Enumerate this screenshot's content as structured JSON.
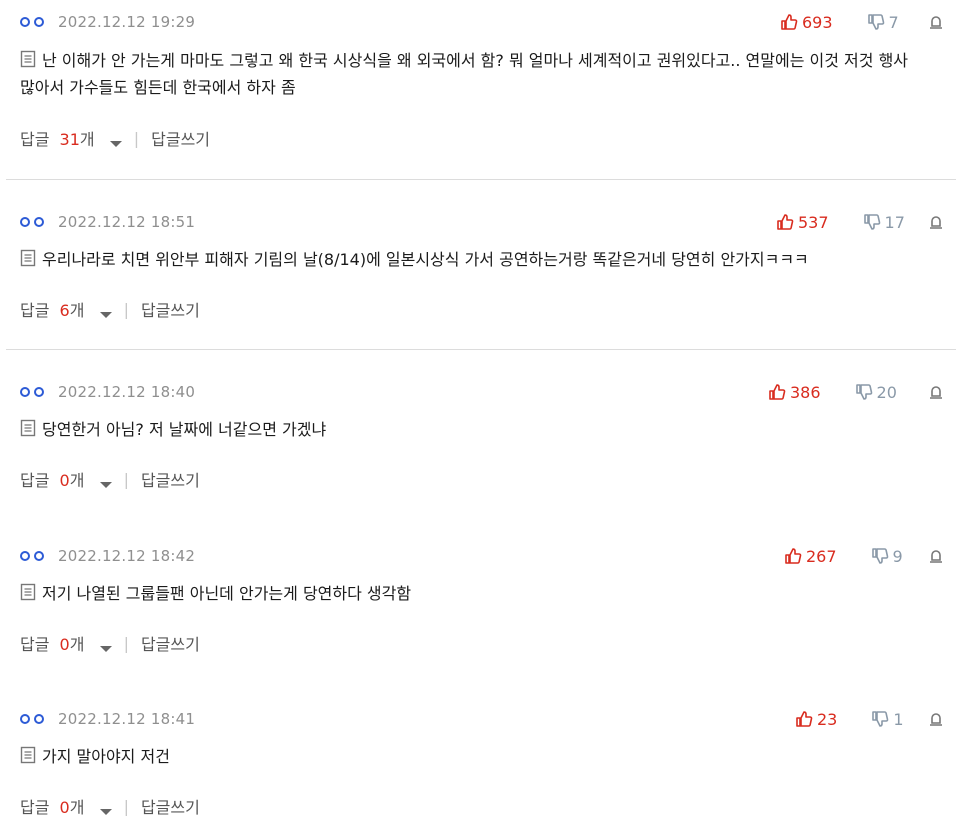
{
  "colors": {
    "accent_blue": "#2d5bd6",
    "like_red": "#d92c1f",
    "dislike_gray": "#8a99a8",
    "meta_gray": "#8f8f8f",
    "divider": "#dcdcdc"
  },
  "comments": [
    {
      "timestamp": "2022.12.12 19:29",
      "likes": "693",
      "dislikes": "7",
      "text": "난 이해가 안 가는게 마마도 그렇고 왜 한국 시상식을 왜 외국에서 함? 뭐 얼마나 세계적이고 권위있다고.. 연말에는 이것 저것 행사 많아서 가수들도 힘든데 한국에서 하자 좀",
      "reply_prefix": "답글",
      "reply_count": "31",
      "reply_unit": "개",
      "write_reply": "답글쓰기"
    },
    {
      "timestamp": "2022.12.12 18:51",
      "likes": "537",
      "dislikes": "17",
      "text": "우리나라로 치면 위안부 피해자 기림의 날(8/14)에 일본시상식 가서 공연하는거랑 똑같은거네 당연히 안가지ㅋㅋㅋ",
      "reply_prefix": "답글",
      "reply_count": "6",
      "reply_unit": "개",
      "write_reply": "답글쓰기"
    },
    {
      "timestamp": "2022.12.12 18:40",
      "likes": "386",
      "dislikes": "20",
      "text": "당연한거 아님? 저 날짜에 너같으면 가겠냐",
      "reply_prefix": "답글",
      "reply_count": "0",
      "reply_unit": "개",
      "write_reply": "답글쓰기"
    },
    {
      "timestamp": "2022.12.12 18:42",
      "likes": "267",
      "dislikes": "9",
      "text": "저기 나열된 그룹들팬 아닌데 안가는게 당연하다 생각함",
      "reply_prefix": "답글",
      "reply_count": "0",
      "reply_unit": "개",
      "write_reply": "답글쓰기"
    },
    {
      "timestamp": "2022.12.12 18:41",
      "likes": "23",
      "dislikes": "1",
      "text": "가지 말아야지 저건",
      "reply_prefix": "답글",
      "reply_count": "0",
      "reply_unit": "개",
      "write_reply": "답글쓰기"
    }
  ]
}
